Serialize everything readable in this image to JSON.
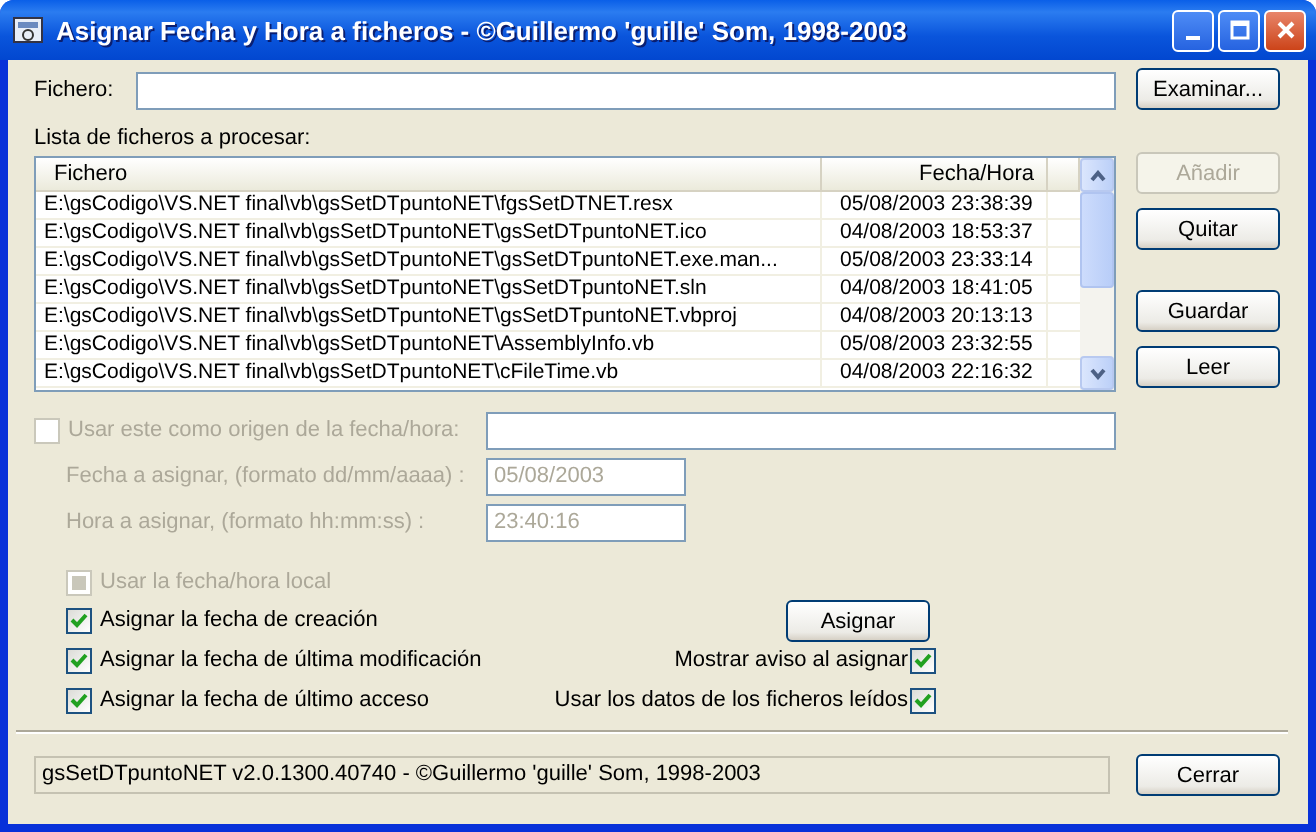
{
  "window": {
    "title": "Asignar Fecha y Hora a ficheros - ©Guillermo 'guille' Som, 1998-2003"
  },
  "file_field": {
    "label": "Fichero:"
  },
  "browse_button": {
    "label": "Examinar...",
    "disabled": false
  },
  "list": {
    "label": "Lista de ficheros a procesar:",
    "columns": [
      "Fichero",
      "Fecha/Hora"
    ],
    "rows": [
      {
        "file": "E:\\gsCodigo\\VS.NET final\\vb\\gsSetDTpuntoNET\\fgsSetDTNET.resx",
        "datetime": "05/08/2003 23:38:39"
      },
      {
        "file": "E:\\gsCodigo\\VS.NET final\\vb\\gsSetDTpuntoNET\\gsSetDTpuntoNET.ico",
        "datetime": "04/08/2003 18:53:37"
      },
      {
        "file": "E:\\gsCodigo\\VS.NET final\\vb\\gsSetDTpuntoNET\\gsSetDTpuntoNET.exe.man...",
        "datetime": "05/08/2003 23:33:14"
      },
      {
        "file": "E:\\gsCodigo\\VS.NET final\\vb\\gsSetDTpuntoNET\\gsSetDTpuntoNET.sln",
        "datetime": "04/08/2003 18:41:05"
      },
      {
        "file": "E:\\gsCodigo\\VS.NET final\\vb\\gsSetDTpuntoNET\\gsSetDTpuntoNET.vbproj",
        "datetime": "04/08/2003 20:13:13"
      },
      {
        "file": "E:\\gsCodigo\\VS.NET final\\vb\\gsSetDTpuntoNET\\AssemblyInfo.vb",
        "datetime": "05/08/2003 23:32:55"
      },
      {
        "file": "E:\\gsCodigo\\VS.NET final\\vb\\gsSetDTpuntoNET\\cFileTime.vb",
        "datetime": "04/08/2003 22:16:32"
      }
    ]
  },
  "side_buttons": [
    {
      "label": "Añadir",
      "disabled": true
    },
    {
      "label": "Quitar",
      "disabled": false
    },
    {
      "label": "Guardar",
      "disabled": false
    },
    {
      "label": "Leer",
      "disabled": false
    }
  ],
  "source": {
    "label": "Usar este como origen de la fecha/hora:",
    "checked": false,
    "disabled": true
  },
  "date_field": {
    "label": "Fecha a asignar, (formato dd/mm/aaaa) :",
    "value": "05/08/2003",
    "disabled": true
  },
  "time_field": {
    "label": "Hora a asignar, (formato hh:mm:ss) :",
    "value": "23:40:16",
    "disabled": true
  },
  "local_time": {
    "label": "Usar la fecha/hora local",
    "checked": true,
    "disabled": true
  },
  "assign_options": [
    {
      "label": "Asignar la fecha de creación",
      "checked": true
    },
    {
      "label": "Asignar la fecha de última modificación",
      "checked": true
    },
    {
      "label": "Asignar la fecha de último acceso",
      "checked": true
    }
  ],
  "assign_button": {
    "label": "Asignar",
    "disabled": false
  },
  "right_options": [
    {
      "label": "Mostrar aviso al asignar",
      "checked": true
    },
    {
      "label": "Usar los datos de los ficheros leídos",
      "checked": true
    }
  ],
  "status": "gsSetDTpuntoNET v2.0.1300.40740 - ©Guillermo 'guille' Som, 1998-2003",
  "close_button": {
    "label": "Cerrar",
    "disabled": false
  }
}
